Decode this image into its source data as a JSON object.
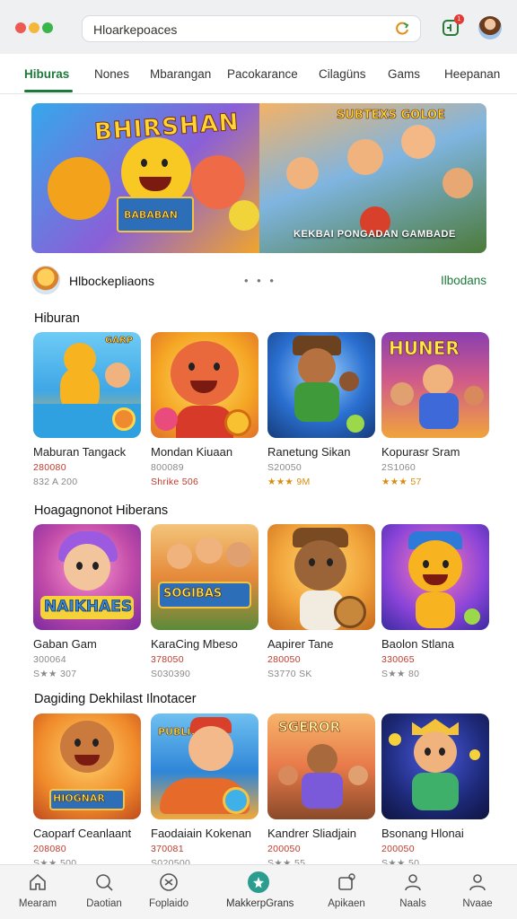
{
  "browser": {
    "url": "Hloarkepoaces",
    "notification_count": "1"
  },
  "tabs": [
    {
      "label": "Hiburas",
      "active": true
    },
    {
      "label": "Nones"
    },
    {
      "label": "Mbarangan"
    },
    {
      "label": "Pacokarance"
    },
    {
      "label": "Cilagüns"
    },
    {
      "label": "Gams"
    },
    {
      "label": "Heepanan"
    }
  ],
  "hero": {
    "title": "BHIRSHAN",
    "left_sign": "BABABAN",
    "right_title": "SUBTEXS GOLOE",
    "caption": "KEKBAI PONGADAN GAMBADE"
  },
  "developer": {
    "name": "Hlbockepliaons",
    "more": "• • •",
    "link": "Ilbodans"
  },
  "sections": [
    {
      "title": "Hiburan",
      "apps": [
        {
          "name": "Maburan Tangack",
          "line1": "280080",
          "line2": "832 A 200",
          "thumb_text": "GARP"
        },
        {
          "name": "Mondan Kiuaan",
          "line1": "800089",
          "line2": "Shrike 506",
          "thumb_text": ""
        },
        {
          "name": "Ranetung Sikan",
          "line1": "S20050",
          "line2": "★★★ 9M",
          "thumb_text": ""
        },
        {
          "name": "Kopurasr Sram",
          "line1": "2S1060",
          "line2": "★★★ 57",
          "thumb_text": "HUNER"
        }
      ]
    },
    {
      "title": "Hoagagnonot Hiberans",
      "apps": [
        {
          "name": "Gaban Gam",
          "line1": "300064",
          "line2": "S★★ 307",
          "thumb_text": "NAIKHAES"
        },
        {
          "name": "KaraCing Mbeso",
          "line1": "378050",
          "line2": "S030390",
          "thumb_text": "SOGIBAS"
        },
        {
          "name": "Aapirer Tane",
          "line1": "280050",
          "line2": "S3770 SK",
          "thumb_text": ""
        },
        {
          "name": "Baolon Stlana",
          "line1": "330065",
          "line2": "S★★ 80",
          "thumb_text": ""
        }
      ]
    },
    {
      "title": "Dagiding Dekhilast Ilnotacer",
      "apps": [
        {
          "name": "Caoparf Ceanlaant",
          "line1": "208080",
          "line2": "S★★ 500",
          "thumb_text": "HIOGNAR"
        },
        {
          "name": "Faodaiain Kokenan",
          "line1": "370081",
          "line2": "S020500",
          "thumb_text": "PUBLIO"
        },
        {
          "name": "Kandrer Sliadjain",
          "line1": "200050",
          "line2": "S★★ 55",
          "thumb_text": "SGEROR"
        },
        {
          "name": "Bsonang Hlonai",
          "line1": "200050",
          "line2": "S★★ 50",
          "thumb_text": ""
        }
      ]
    }
  ],
  "bottom_nav": [
    {
      "label": "Mearam",
      "icon": "home-icon"
    },
    {
      "label": "Daotian",
      "icon": "search-icon"
    },
    {
      "label": "Foplaido",
      "icon": "games-icon"
    },
    {
      "label": "MakkerpGrans",
      "icon": "star-icon",
      "active": true
    },
    {
      "label": "Apikaen",
      "icon": "apps-icon"
    },
    {
      "label": "Naals",
      "icon": "user-icon"
    },
    {
      "label": "Nvaae",
      "icon": "profile-icon"
    }
  ],
  "colors": {
    "accent": "#1b7a3a",
    "price_red": "#c0392b",
    "rating_gold": "#d98b0b",
    "nav_active": "#2a9d8f"
  }
}
